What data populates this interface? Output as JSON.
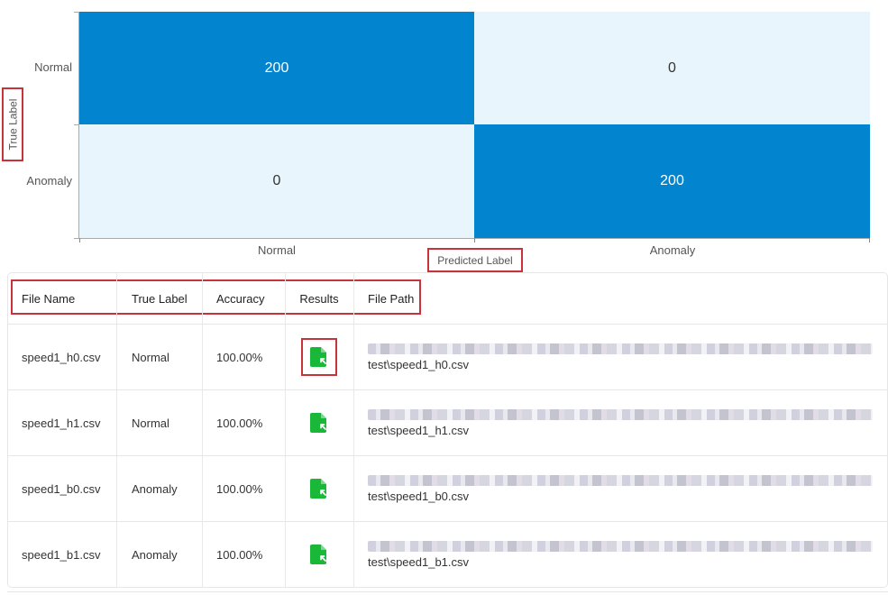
{
  "chart_data": {
    "type": "heatmap",
    "title": "",
    "xlabel": "Predicted Label",
    "ylabel": "True Label",
    "x_categories": [
      "Normal",
      "Anomaly"
    ],
    "y_categories": [
      "Normal",
      "Anomaly"
    ],
    "values": [
      [
        200,
        0
      ],
      [
        0,
        200
      ]
    ],
    "colors": {
      "high": "#0384cf",
      "low": "#e8f5fd"
    }
  },
  "table": {
    "columns": [
      "File Name",
      "True Label",
      "Accuracy",
      "Results",
      "File Path"
    ],
    "rows": [
      {
        "file_name": "speed1_h0.csv",
        "true_label": "Normal",
        "accuracy": "100.00%",
        "results_icon": "file-export-icon",
        "file_path": "test\\speed1_h0.csv"
      },
      {
        "file_name": "speed1_h1.csv",
        "true_label": "Normal",
        "accuracy": "100.00%",
        "results_icon": "file-export-icon",
        "file_path": "test\\speed1_h1.csv"
      },
      {
        "file_name": "speed1_b0.csv",
        "true_label": "Anomaly",
        "accuracy": "100.00%",
        "results_icon": "file-export-icon",
        "file_path": "test\\speed1_b0.csv"
      },
      {
        "file_name": "speed1_b1.csv",
        "true_label": "Anomaly",
        "accuracy": "100.00%",
        "results_icon": "file-export-icon",
        "file_path": "test\\speed1_b1.csv"
      }
    ],
    "icon_color": "#19b839",
    "highlight_color": "#c8323a"
  }
}
